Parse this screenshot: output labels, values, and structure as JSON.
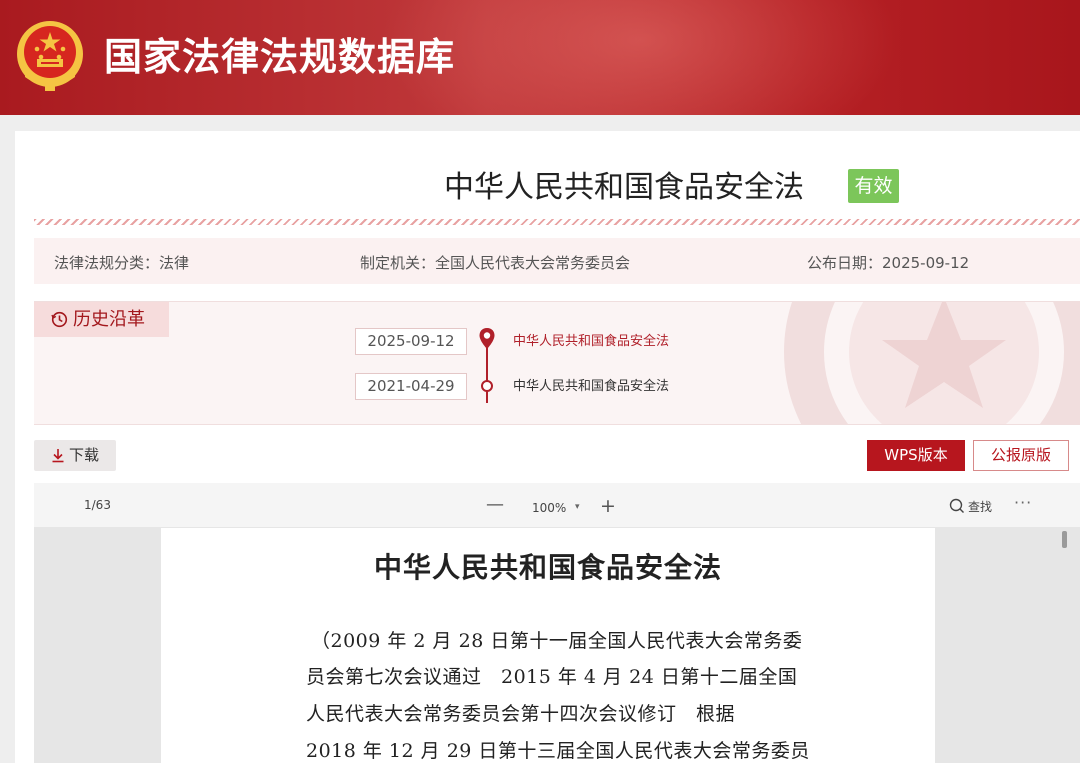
{
  "header": {
    "site_title": "国家法律法规数据库",
    "emblem_icon": "national-emblem-icon",
    "colors": {
      "brand_red": "#b52024",
      "emblem_gold": "#f5c443"
    }
  },
  "law": {
    "title": "中华人民共和国食品安全法",
    "status": "有效",
    "status_color": "#7cc65a"
  },
  "meta": {
    "category": "法律法规分类：法律",
    "authority": "制定机关：全国人民代表大会常务委员会",
    "published": "公布日期：2025-09-12"
  },
  "history": {
    "tab_label": "历史沿革",
    "tab_icon": "clock-history-icon",
    "entries": [
      {
        "date": "2025-09-12",
        "title": "中华人民共和国食品安全法",
        "active": true
      },
      {
        "date": "2021-04-29",
        "title": "中华人民共和国食品安全法",
        "active": false
      }
    ]
  },
  "actions": {
    "download_label": "下载",
    "download_icon": "download-icon",
    "wps_label": "WPS版本",
    "gazette_label": "公报原版"
  },
  "viewer": {
    "page_indicator": "1/63",
    "zoom_out_symbol": "—",
    "zoom_level": "100%",
    "zoom_caret": "▾",
    "zoom_in_symbol": "+",
    "search_label": "查找",
    "more_symbol": "···"
  },
  "document": {
    "title": "中华人民共和国食品安全法",
    "lines": [
      "（2009 年 2 月 28 日第十一届全国人民代表大会常务委",
      "员会第七次会议通过　2015 年 4 月 24 日第十二届全国",
      "人民代表大会常务委员会第十四次会议修订　根据",
      "2018 年 12 月 29 日第十三届全国人民代表大会常务委员"
    ]
  }
}
